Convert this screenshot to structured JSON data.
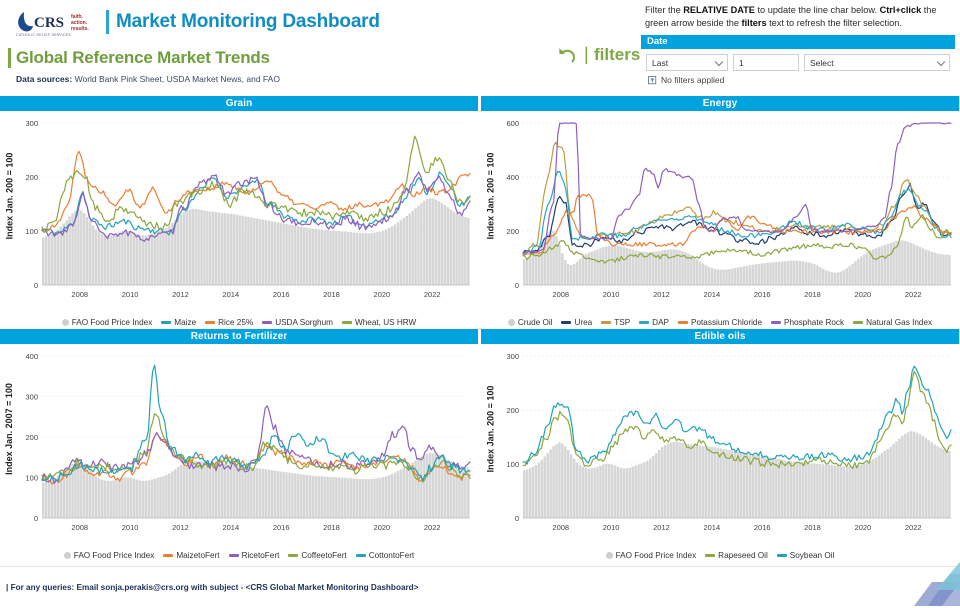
{
  "header": {
    "logo": {
      "brand": "CRS",
      "tagline_lines": [
        "faith.",
        "action.",
        "results."
      ],
      "org_name": "CATHOLIC RELIEF SERVICES"
    },
    "main_title": "Market Monitoring Dashboard",
    "sub_title": "Global Reference Market Trends",
    "data_sources_label": "Data sources:",
    "data_sources_value": "World Bank Pink Sheet, USDA Market News, and FAO",
    "filters_label": "filters",
    "filters_divider": "|",
    "instructions_html": "Filter the <b>RELATIVE DATE</b> to update the line char below. <b>Ctrl+click</b> the green arrow beside the <b>filters</b> text to refresh the filter selection.",
    "instructions_plain": "Filter the RELATIVE DATE to update the line char below. Ctrl+click the green arrow beside the filters text to refresh the filter selection."
  },
  "date_filter": {
    "panel_title": "Date",
    "operator": "Last",
    "count": "1",
    "unit": "Select",
    "status": "No filters applied"
  },
  "colors": {
    "accent_blue": "#00a3dd",
    "title_blue": "#0f8dc4",
    "green": "#7ea843",
    "navy": "#1c3157",
    "fao_gray": "#cfcfcf",
    "teal": "#22a3b8",
    "orange": "#ed7d31",
    "purple": "#8e5fbf",
    "olive": "#8aa83c",
    "dark_navy_line": "#1f3f73",
    "tan": "#c49a3e",
    "cyan": "#2aa8c4"
  },
  "footer": {
    "text": "| For any queries: Email sonja.perakis@crs.org with subject - <CRS Global Market Monitoring Dashboard>"
  },
  "chart_data": [
    {
      "id": "grain",
      "type": "line",
      "title": "Grain",
      "ylabel": "Index Jan. 200 = 100",
      "xlabel": "",
      "ylim": [
        0,
        300
      ],
      "yticks": [
        0,
        100,
        200,
        300
      ],
      "xticks": [
        "2008",
        "2010",
        "2012",
        "2014",
        "2016",
        "2018",
        "2020",
        "2022"
      ],
      "xlim": [
        2006.5,
        2023.5
      ],
      "grid": true,
      "legend_position": "bottom",
      "area_series": {
        "name": "FAO Food Price Index",
        "color": "#cfcfcf",
        "values": [
          88,
          90,
          92,
          95,
          98,
          103,
          108,
          114,
          120,
          127,
          133,
          137,
          140,
          138,
          133,
          126,
          118,
          110,
          103,
          98,
          95,
          93,
          92,
          92,
          93,
          95,
          97,
          99,
          100,
          100,
          99,
          97,
          95,
          93,
          92,
          92,
          93,
          95,
          97,
          99,
          101,
          103,
          106,
          110,
          115,
          120,
          126,
          131,
          135,
          138,
          140,
          141,
          141,
          140,
          139,
          138,
          137,
          136,
          136,
          135,
          134,
          133,
          133,
          132,
          132,
          131,
          130,
          129,
          128,
          127,
          126,
          125,
          124,
          123,
          122,
          121,
          120,
          119,
          118,
          117,
          116,
          115,
          114,
          113,
          112,
          111,
          110,
          109,
          108,
          107,
          106,
          105,
          104,
          104,
          103,
          103,
          102,
          102,
          101,
          101,
          100,
          100,
          99,
          99,
          98,
          98,
          97,
          97,
          96,
          96,
          96,
          96,
          96,
          97,
          98,
          99,
          101,
          103,
          106,
          109,
          112,
          116,
          120,
          124,
          128,
          132,
          137,
          142,
          147,
          152,
          156,
          159,
          161,
          160,
          158,
          155,
          152,
          148,
          144,
          140,
          136,
          133,
          130,
          128,
          126,
          124
        ]
      },
      "series": [
        {
          "name": "Maize",
          "color": "#22a3b8"
        },
        {
          "name": "Rice 25%",
          "color": "#ed7d31"
        },
        {
          "name": "USDA Sorghum",
          "color": "#8e5fbf"
        },
        {
          "name": "Wheat, US HRW",
          "color": "#8aa83c"
        }
      ]
    },
    {
      "id": "energy",
      "type": "line",
      "title": "Energy",
      "ylabel": "Index Jan. 200 = 100",
      "xlabel": "",
      "ylim": [
        0,
        600
      ],
      "yticks": [
        0,
        200,
        400,
        600
      ],
      "xticks": [
        "2008",
        "2010",
        "2012",
        "2014",
        "2016",
        "2018",
        "2020",
        "2022"
      ],
      "xlim": [
        2006.5,
        2023.5
      ],
      "grid": true,
      "legend_position": "bottom",
      "area_series": {
        "name": "Crude Oil",
        "color": "#cfcfcf",
        "values": [
          95,
          100,
          108,
          118,
          130,
          145,
          160,
          178,
          195,
          205,
          200,
          180,
          150,
          118,
          92,
          78,
          74,
          78,
          86,
          96,
          106,
          114,
          120,
          124,
          128,
          132,
          136,
          140,
          143,
          145,
          146,
          146,
          145,
          143,
          140,
          137,
          134,
          131,
          128,
          126,
          124,
          123,
          122,
          122,
          123,
          124,
          126,
          128,
          130,
          131,
          132,
          132,
          131,
          129,
          126,
          122,
          117,
          111,
          104,
          96,
          88,
          80,
          73,
          67,
          63,
          60,
          58,
          57,
          57,
          58,
          59,
          61,
          63,
          65,
          67,
          69,
          71,
          73,
          75,
          77,
          78,
          80,
          81,
          82,
          83,
          84,
          85,
          86,
          87,
          88,
          89,
          90,
          90,
          90,
          89,
          88,
          86,
          84,
          81,
          77,
          72,
          66,
          60,
          54,
          50,
          47,
          46,
          47,
          50,
          55,
          62,
          70,
          79,
          88,
          97,
          106,
          114,
          121,
          127,
          132,
          136,
          140,
          144,
          148,
          152,
          156,
          160,
          163,
          165,
          165,
          163,
          160,
          156,
          151,
          146,
          141,
          136,
          131,
          127,
          123,
          120,
          117,
          115,
          113,
          112,
          111
        ]
      },
      "series": [
        {
          "name": "Urea",
          "color": "#1f3f73"
        },
        {
          "name": "TSP",
          "color": "#c49a3e"
        },
        {
          "name": "DAP",
          "color": "#2aa8c4"
        },
        {
          "name": "Potassium Chloride",
          "color": "#ed7d31"
        },
        {
          "name": "Phosphate Rock",
          "color": "#8e5fbf"
        },
        {
          "name": "Natural Gas Index",
          "color": "#8aa83c"
        }
      ]
    },
    {
      "id": "returns_to_fertilizer",
      "type": "line",
      "title": "Returns to Fertilizer",
      "ylabel": "Index Jan. 2007 = 100",
      "xlabel": "",
      "ylim": [
        0,
        400
      ],
      "yticks": [
        0,
        100,
        200,
        300,
        400
      ],
      "xticks": [
        "2008",
        "2010",
        "2012",
        "2014",
        "2016",
        "2018",
        "2020",
        "2022"
      ],
      "xlim": [
        2006.5,
        2023.5
      ],
      "grid": true,
      "legend_position": "bottom",
      "area_series": {
        "name": "FAO Food Price Index",
        "color": "#cfcfcf",
        "values": [
          88,
          90,
          92,
          95,
          98,
          103,
          108,
          114,
          120,
          127,
          133,
          137,
          140,
          138,
          133,
          126,
          118,
          110,
          103,
          98,
          95,
          93,
          92,
          92,
          93,
          95,
          97,
          99,
          100,
          100,
          99,
          97,
          95,
          93,
          92,
          92,
          93,
          95,
          97,
          99,
          101,
          103,
          106,
          110,
          115,
          120,
          126,
          131,
          135,
          138,
          140,
          141,
          141,
          140,
          139,
          138,
          137,
          136,
          136,
          135,
          134,
          133,
          133,
          132,
          132,
          131,
          130,
          129,
          128,
          127,
          126,
          125,
          124,
          123,
          122,
          121,
          120,
          119,
          118,
          117,
          116,
          115,
          114,
          113,
          112,
          111,
          110,
          109,
          108,
          107,
          106,
          105,
          104,
          104,
          103,
          103,
          102,
          102,
          101,
          101,
          100,
          100,
          99,
          99,
          98,
          98,
          97,
          97,
          96,
          96,
          96,
          96,
          96,
          97,
          98,
          99,
          101,
          103,
          106,
          109,
          112,
          116,
          120,
          124,
          128,
          132,
          137,
          142,
          147,
          152,
          156,
          159,
          161,
          160,
          158,
          155,
          152,
          148,
          144,
          140,
          136,
          133,
          130,
          128,
          126,
          124
        ]
      },
      "series": [
        {
          "name": "MaizetoFert",
          "color": "#ed7d31"
        },
        {
          "name": "RicetoFert",
          "color": "#8e5fbf"
        },
        {
          "name": "CoffeetoFert",
          "color": "#8aa83c"
        },
        {
          "name": "CottontoFert",
          "color": "#22a3b8"
        }
      ]
    },
    {
      "id": "edible_oils",
      "type": "line",
      "title": "Edible oils",
      "ylabel": "Index Jan. 200 = 100",
      "xlabel": "",
      "ylim": [
        0,
        300
      ],
      "yticks": [
        0,
        100,
        200,
        300
      ],
      "xticks": [
        "2008",
        "2010",
        "2012",
        "2014",
        "2016",
        "2018",
        "2020",
        "2022"
      ],
      "xlim": [
        2006.5,
        2023.5
      ],
      "grid": true,
      "legend_position": "bottom",
      "area_series": {
        "name": "FAO Food Price Index",
        "color": "#cfcfcf",
        "values": [
          88,
          90,
          92,
          95,
          98,
          103,
          108,
          114,
          120,
          127,
          133,
          137,
          140,
          138,
          133,
          126,
          118,
          110,
          103,
          98,
          95,
          93,
          92,
          92,
          93,
          95,
          97,
          99,
          100,
          100,
          99,
          97,
          95,
          93,
          92,
          92,
          93,
          95,
          97,
          99,
          101,
          103,
          106,
          110,
          115,
          120,
          126,
          131,
          135,
          138,
          140,
          141,
          141,
          140,
          139,
          138,
          137,
          136,
          136,
          135,
          134,
          133,
          133,
          132,
          132,
          131,
          130,
          129,
          128,
          127,
          126,
          125,
          124,
          123,
          122,
          121,
          120,
          119,
          118,
          117,
          116,
          115,
          114,
          113,
          112,
          111,
          110,
          109,
          108,
          107,
          106,
          105,
          104,
          104,
          103,
          103,
          102,
          102,
          101,
          101,
          100,
          100,
          99,
          99,
          98,
          98,
          97,
          97,
          96,
          96,
          96,
          96,
          96,
          97,
          98,
          99,
          101,
          103,
          106,
          109,
          112,
          116,
          120,
          124,
          128,
          132,
          137,
          142,
          147,
          152,
          156,
          159,
          161,
          160,
          158,
          155,
          152,
          148,
          144,
          140,
          136,
          133,
          130,
          128,
          126,
          124
        ]
      },
      "series": [
        {
          "name": "Rapeseed Oil",
          "color": "#8aa83c"
        },
        {
          "name": "Soybean Oil",
          "color": "#22a3b8"
        }
      ]
    }
  ]
}
